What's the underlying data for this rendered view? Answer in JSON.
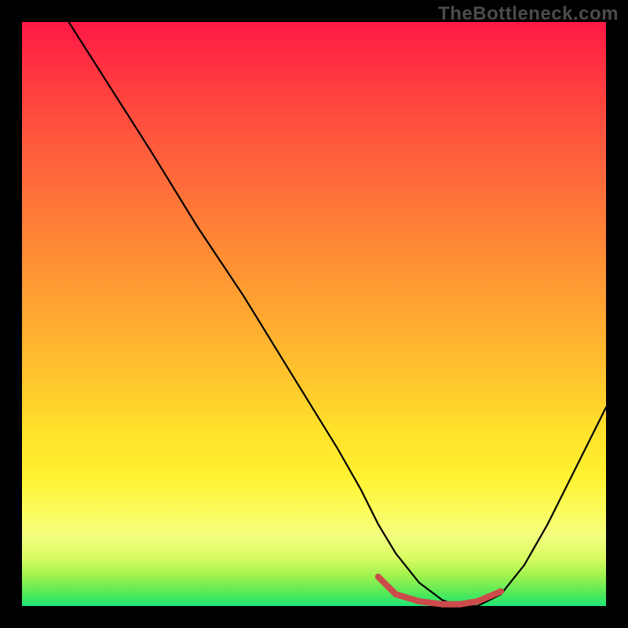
{
  "watermark": "TheBottleneck.com",
  "chart_data": {
    "type": "line",
    "title": "",
    "xlabel": "",
    "ylabel": "",
    "xlim": [
      0,
      100
    ],
    "ylim": [
      0,
      100
    ],
    "grid": false,
    "series": [
      {
        "name": "curve-main",
        "color": "#000000",
        "x": [
          8,
          15,
          22,
          30,
          38,
          46,
          54,
          58,
          61,
          64,
          68,
          72,
          75,
          78,
          82,
          86,
          90,
          94,
          98,
          100
        ],
        "y": [
          100,
          89,
          78,
          65,
          53,
          40,
          27,
          20,
          14,
          9,
          4,
          1,
          0,
          0,
          2,
          7,
          14,
          22,
          30,
          34
        ]
      },
      {
        "name": "highlight-valley",
        "color": "#cc4b4b",
        "x": [
          61,
          64,
          68,
          72,
          75,
          78,
          82
        ],
        "y": [
          5,
          2,
          0.8,
          0.3,
          0.3,
          0.8,
          2.5
        ]
      }
    ],
    "gradient_stops": [
      {
        "pos": 0,
        "color": "#ff1846"
      },
      {
        "pos": 35,
        "color": "#ff8037"
      },
      {
        "pos": 70,
        "color": "#ffe12a"
      },
      {
        "pos": 88,
        "color": "#f4fe80"
      },
      {
        "pos": 100,
        "color": "#1de577"
      }
    ]
  }
}
